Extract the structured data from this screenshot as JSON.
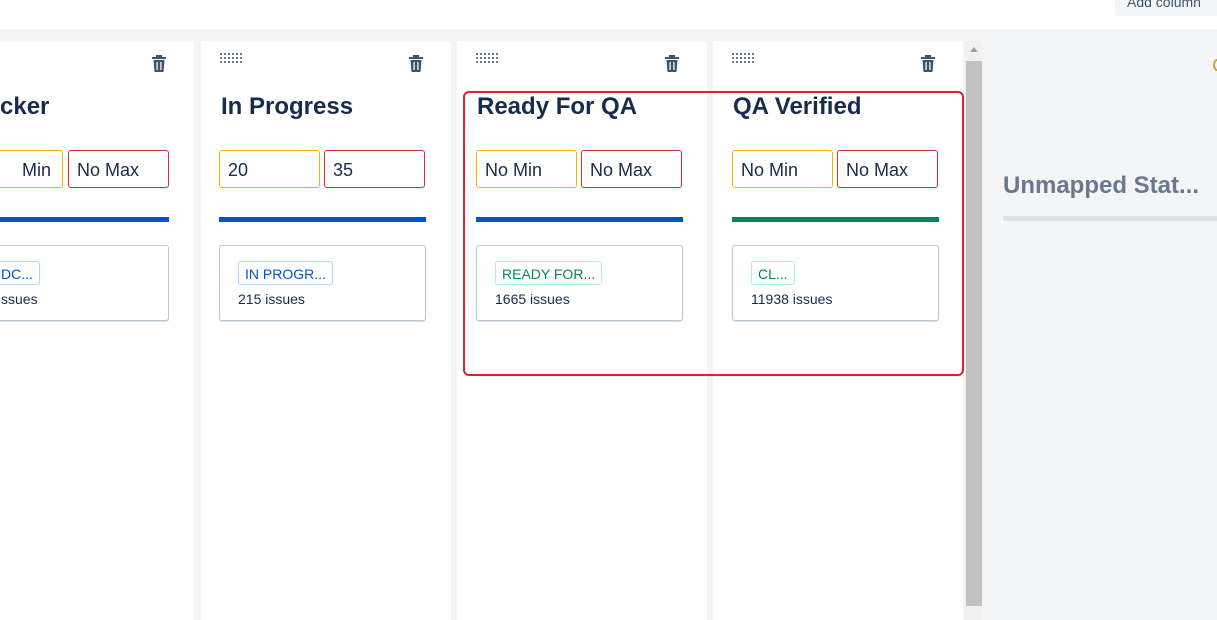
{
  "toolbar": {
    "add_column_label": "Add column"
  },
  "columns": [
    {
      "title": "Blocker",
      "visible_title": "cker",
      "min": "No Min",
      "visible_min": "Min",
      "max": "No Max",
      "bar_color": "#0052cc",
      "status": "TO DOC...",
      "visible_status": "DC...",
      "status_color": "blue",
      "issues": "issues",
      "visible_issues": "ssues"
    },
    {
      "title": "In Progress",
      "min": "20",
      "max": "35",
      "bar_color": "#0052cc",
      "status": "IN PROGR...",
      "status_color": "blue",
      "issues": "215 issues"
    },
    {
      "title": "Ready For QA",
      "min": "No Min",
      "max": "No Max",
      "bar_color": "#0052cc",
      "status": "READY FOR...",
      "status_color": "green",
      "issues": "1665 issues"
    },
    {
      "title": "QA Verified",
      "min": "No Min",
      "max": "No Max",
      "bar_color": "#00875a",
      "status": "CL...",
      "status_color": "green",
      "issues": "11938 issues"
    }
  ],
  "unmapped": {
    "title": "Unmapped Stat..."
  },
  "icons": {
    "drag": "drag-handle-icon",
    "delete": "trash-icon"
  },
  "colors": {
    "highlight": "#e2202c",
    "min_border": "#f2b500",
    "max_border": "#c9372c"
  }
}
